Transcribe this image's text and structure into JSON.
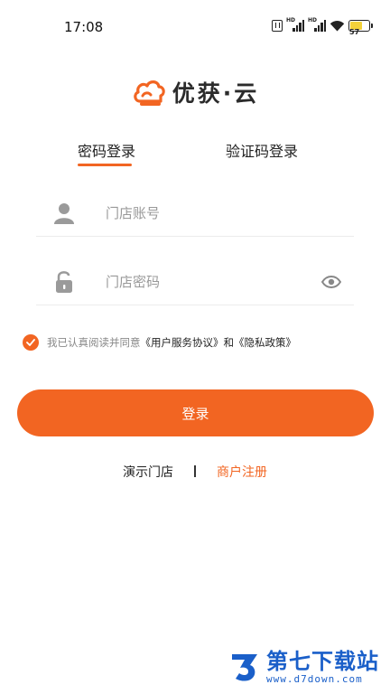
{
  "status_bar": {
    "time": "17:08",
    "battery_level": "57",
    "network_label": "HD"
  },
  "brand": {
    "name": "优获·云",
    "accent_color": "#f26522"
  },
  "tabs": [
    {
      "label": "密码登录",
      "active": true
    },
    {
      "label": "验证码登录",
      "active": false
    }
  ],
  "form": {
    "account_placeholder": "门店账号",
    "password_placeholder": "门店密码"
  },
  "agreement": {
    "checked": true,
    "prefix": "我已认真阅读并同意",
    "user_agreement": "《用户服务协议》",
    "and": "和",
    "privacy_policy": "《隐私政策》"
  },
  "login_button": "登录",
  "footer": {
    "demo_store": "演示门店",
    "divider": "|",
    "register": "商户注册"
  },
  "watermark": {
    "title": "第七下载站",
    "url": "www.d7down.com"
  }
}
